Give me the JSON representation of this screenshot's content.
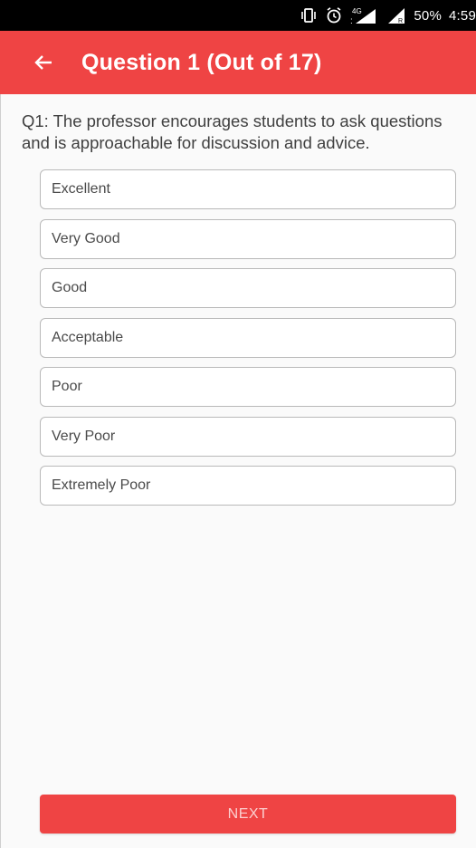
{
  "status_bar": {
    "network_label": "4G",
    "battery_text": "50%",
    "time": "4:59",
    "icons": [
      "vibrate-icon",
      "alarm-icon",
      "signal-icon",
      "signal-icon",
      "battery-icon"
    ]
  },
  "app_bar": {
    "title": "Question 1 (Out of 17)",
    "back_icon": "arrow-left-icon",
    "color": "#ef4444"
  },
  "question": {
    "text": "Q1: The professor encourages students to ask questions and is approachable for discussion and advice."
  },
  "options": [
    {
      "label": "Excellent"
    },
    {
      "label": "Very Good"
    },
    {
      "label": "Good"
    },
    {
      "label": "Acceptable"
    },
    {
      "label": "Poor"
    },
    {
      "label": "Very Poor"
    },
    {
      "label": "Extremely Poor"
    }
  ],
  "next_button": {
    "label": "NEXT",
    "color": "#ef4444"
  }
}
